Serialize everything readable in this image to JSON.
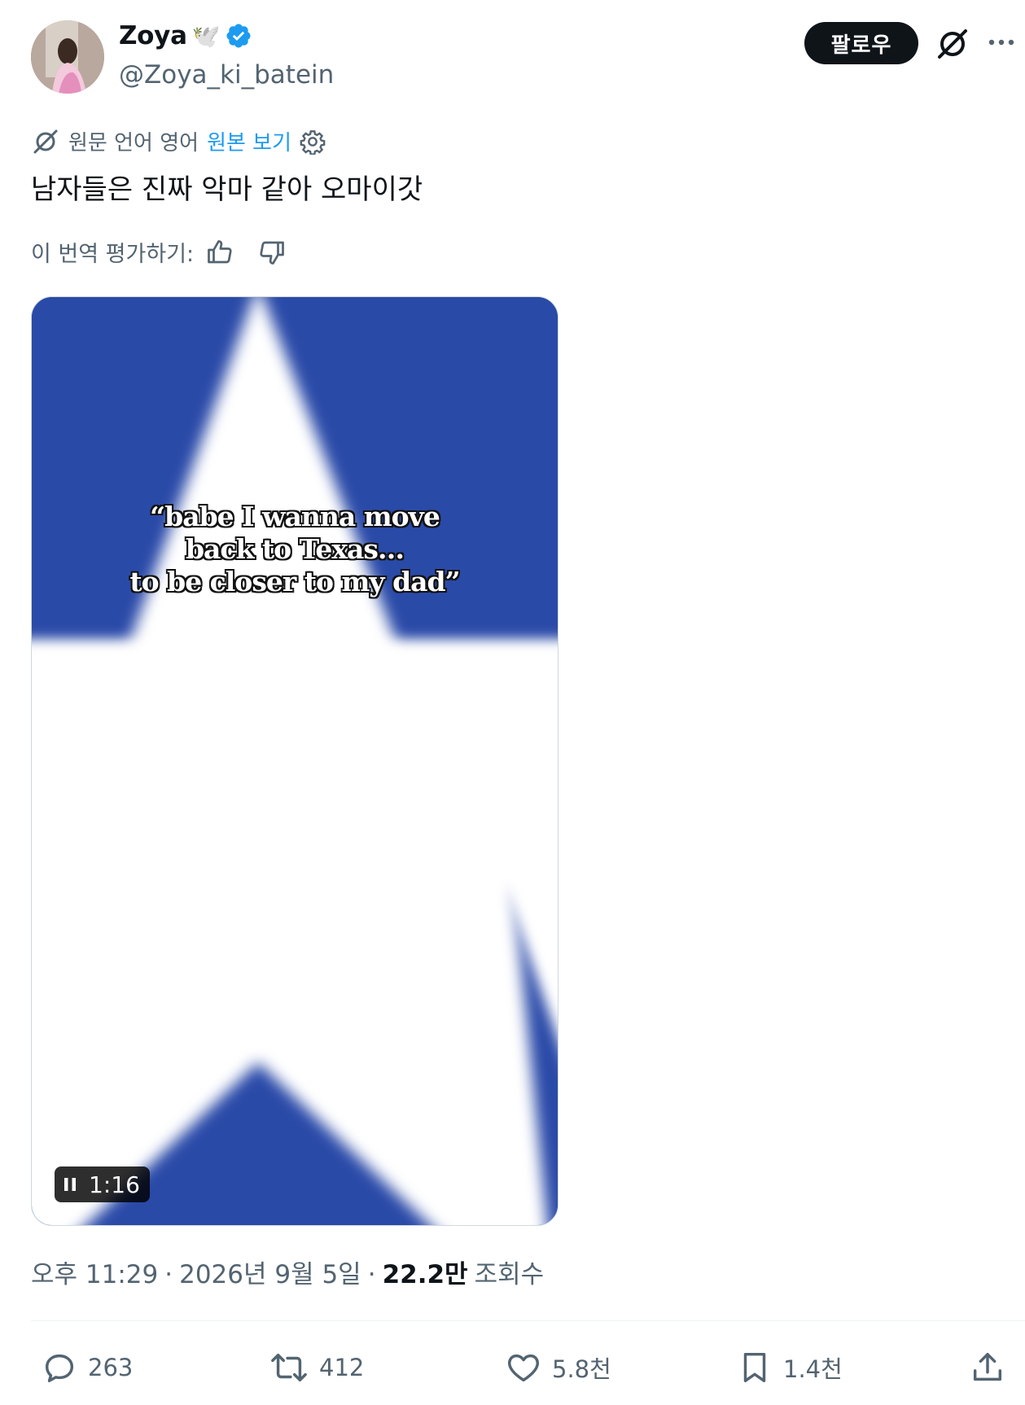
{
  "author": {
    "name": "Zoya",
    "name_emoji": "🕊️",
    "handle": "@Zoya_ki_batein",
    "verified": true
  },
  "header": {
    "follow_label": "팔로우"
  },
  "translation": {
    "notice": "원문 언어 영어",
    "show_original": "원본 보기",
    "text": "남자들은 진짜 악마 같아 오마이갓",
    "rate_label": "이 번역 평가하기:"
  },
  "media": {
    "caption_lines": [
      "“babe I wanna move",
      "back to Texas…",
      "to be closer to my dad”"
    ],
    "duration": "1:16",
    "colors": {
      "flag_blue": "#2a4aa8",
      "star_white": "#ffffff"
    }
  },
  "meta": {
    "time": "오후 11:29",
    "date": "2026년 9월 5일",
    "views_count": "22.2만",
    "views_label": "조회수"
  },
  "actions": {
    "replies": "263",
    "reposts": "412",
    "likes": "5.8천",
    "bookmarks": "1.4천"
  },
  "colors": {
    "accent": "#1d9bf0",
    "text_primary": "#0f1419",
    "text_secondary": "#536471"
  }
}
